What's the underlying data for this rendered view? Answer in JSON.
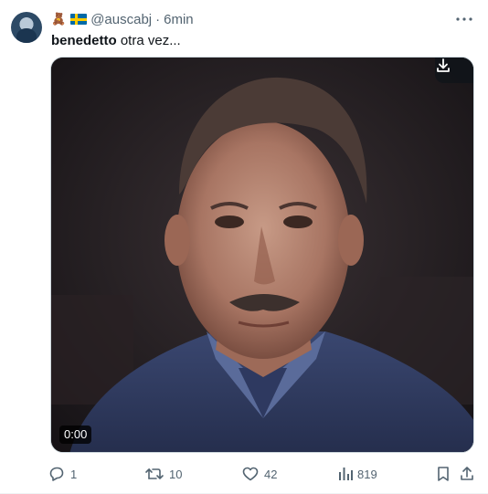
{
  "tweet": {
    "header_emoji": "🧸",
    "handle": "@auscabj",
    "separator": "·",
    "time": "6min",
    "text_bold": "benedetto",
    "text_rest": " otra vez..."
  },
  "media": {
    "duration": "0:00",
    "download_icon": "download-icon"
  },
  "actions": {
    "replies": "1",
    "reposts": "10",
    "likes": "42",
    "views": "819"
  },
  "colors": {
    "muted": "#536471",
    "text": "#0f1419",
    "border": "#cfd9de"
  }
}
